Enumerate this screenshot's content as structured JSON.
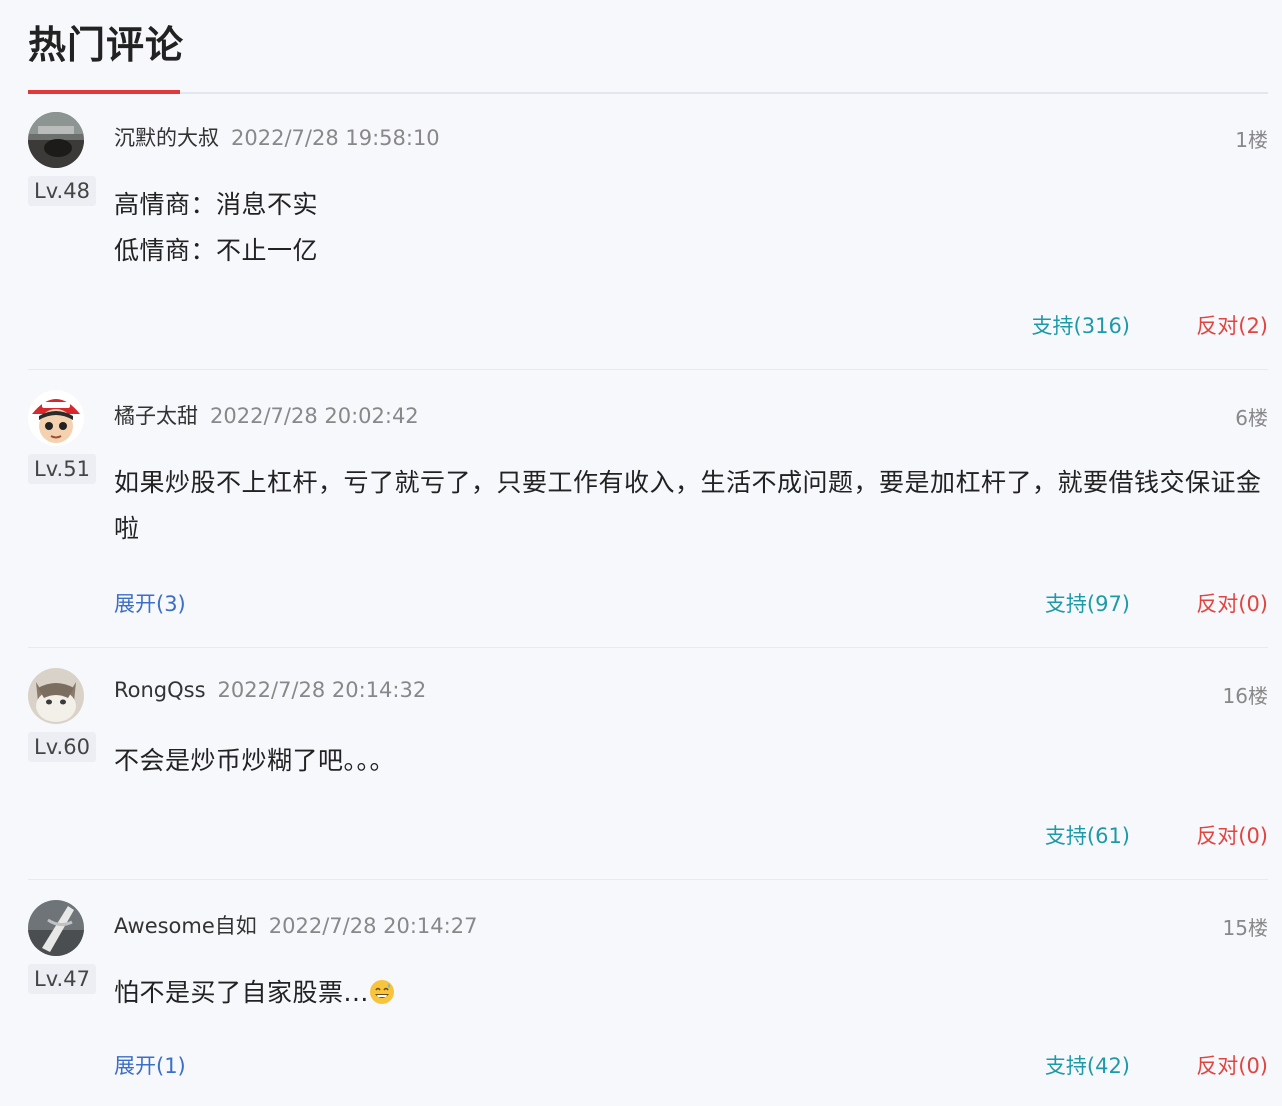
{
  "section": {
    "title": "热门评论"
  },
  "comments": [
    {
      "username": "沉默的大叔",
      "time": "2022/7/28 19:58:10",
      "floor": "1楼",
      "level": "Lv.48",
      "lines": [
        "高情商：消息不实",
        "低情商：不止一亿"
      ],
      "support": "支持(316)",
      "oppose": "反对(2)",
      "expand": ""
    },
    {
      "username": "橘子太甜",
      "time": "2022/7/28 20:02:42",
      "floor": "6楼",
      "level": "Lv.51",
      "lines": [
        "如果炒股不上杠杆，亏了就亏了，只要工作有收入，生活不成问题，要是加杠杆了，就要借钱交保证金啦"
      ],
      "support": "支持(97)",
      "oppose": "反对(0)",
      "expand": "展开(3)"
    },
    {
      "username": "RongQss",
      "time": "2022/7/28 20:14:32",
      "floor": "16楼",
      "level": "Lv.60",
      "lines": [
        "不会是炒币炒糊了吧。。。"
      ],
      "support": "支持(61)",
      "oppose": "反对(0)",
      "expand": ""
    },
    {
      "username": "Awesome自如",
      "time": "2022/7/28 20:14:27",
      "floor": "15楼",
      "level": "Lv.47",
      "lines": [
        "怕不是买了自家股票..."
      ],
      "support": "支持(42)",
      "oppose": "反对(0)",
      "expand": "展开(1)"
    }
  ],
  "icons": {
    "emoji": "grinning-sweat-emoji-icon"
  },
  "colors": {
    "accent": "#e2383a",
    "support": "#1d9aa8",
    "oppose": "#e2443f",
    "expand": "#3b6ec7"
  }
}
